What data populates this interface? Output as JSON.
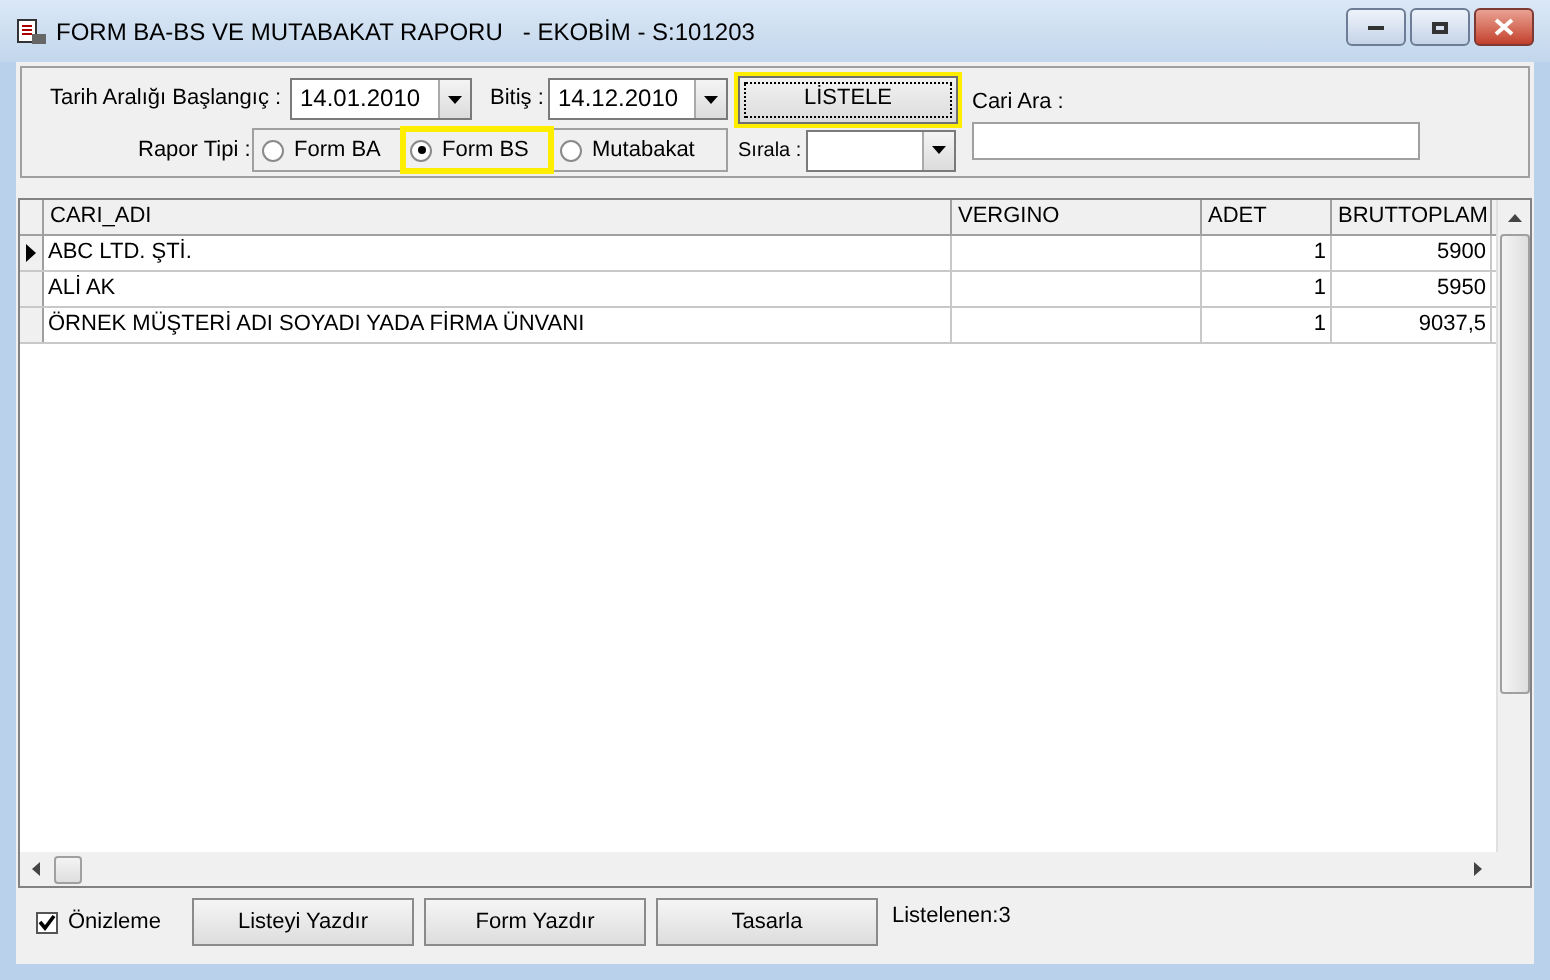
{
  "window": {
    "title": "FORM BA-BS VE MUTABAKAT RAPORU   - EKOBİM - S:101203"
  },
  "filters": {
    "start_label": "Tarih Aralığı Başlangıç :",
    "start_value": "14.01.2010",
    "end_label": "Bitiş :",
    "end_value": "14.12.2010",
    "list_button": {
      "label": "LİSTELE",
      "highlighted": true
    },
    "search_label": "Cari Ara :",
    "report_type_label": "Rapor Tipi :",
    "report_types": [
      {
        "label": "Form BA",
        "selected": false,
        "highlighted": false
      },
      {
        "label": "Form BS",
        "selected": true,
        "highlighted": true
      },
      {
        "label": "Mutabakat",
        "selected": false,
        "highlighted": false
      }
    ],
    "sort_label": "Sırala :"
  },
  "table": {
    "columns": [
      "CARI_ADI",
      "VERGINO",
      "ADET",
      "BRUTTOPLAM"
    ],
    "rows": [
      {
        "cells": [
          "ABC LTD. ŞTİ.",
          "",
          "1",
          "5900"
        ],
        "selected": true
      },
      {
        "cells": [
          "ALİ AK",
          "",
          "1",
          "5950"
        ],
        "selected": false
      },
      {
        "cells": [
          "ÖRNEK MÜŞTERİ ADI SOYADI YADA FİRMA ÜNVANI",
          "",
          "1",
          "9037,5"
        ],
        "selected": false
      }
    ]
  },
  "footer": {
    "preview": {
      "label": "Önizleme",
      "checked": true
    },
    "buttons": [
      "Listeyi Yazdır",
      "Form Yazdır",
      "Tasarla"
    ],
    "status": "Listelenen:3"
  }
}
